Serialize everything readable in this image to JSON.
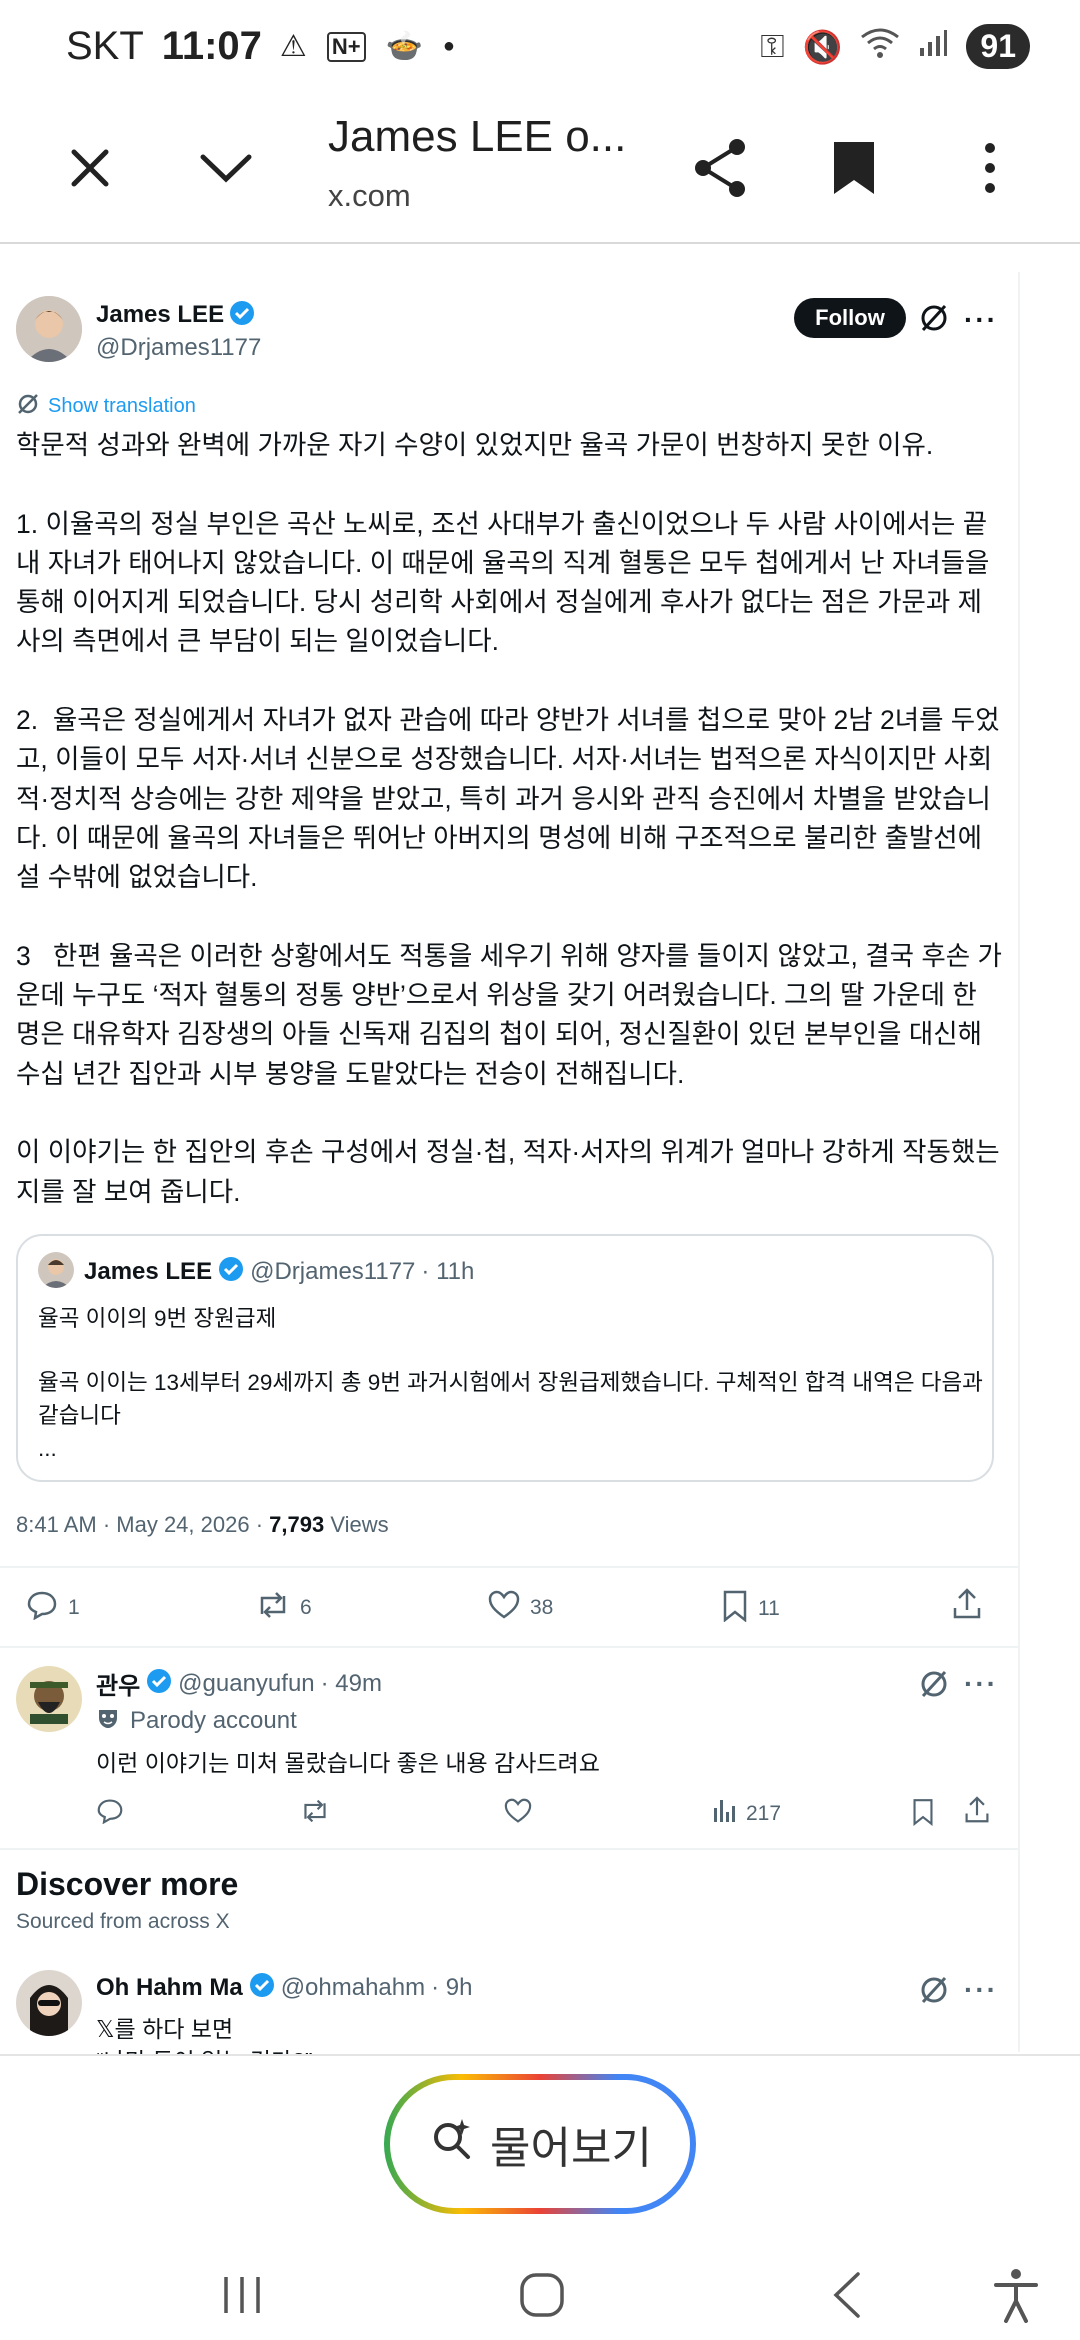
{
  "status_bar": {
    "carrier": "SKT",
    "time": "11:07",
    "battery": "91"
  },
  "browser": {
    "title": "James LEE o...",
    "url": "x.com"
  },
  "tweet": {
    "author_name": "James LEE",
    "author_handle": "@Drjames1177",
    "follow_label": "Follow",
    "translate_label": "Show translation",
    "text": "학문적 성과와 완벽에 가까운 자기 수양이 있었지만 율곡 가문이 번창하지 못한 이유.\n\n1. 이율곡의 정실 부인은 곡산 노씨로, 조선 사대부가 출신이었으나 두 사람 사이에서는 끝내 자녀가 태어나지 않았습니다. 이 때문에 율곡의 직계 혈통은 모두 첩에게서 난 자녀들을 통해 이어지게 되었습니다. 당시 성리학 사회에서 정실에게 후사가 없다는 점은 가문과 제사의 측면에서 큰 부담이 되는 일이었습니다.\n\n2.  율곡은 정실에게서 자녀가 없자 관습에 따라 양반가 서녀를 첩으로 맞아 2남 2녀를 두었고, 이들이 모두 서자·서녀 신분으로 성장했습니다. 서자·서녀는 법적으론 자식이지만 사회적·정치적 상승에는 강한 제약을 받았고, 특히 과거 응시와 관직 승진에서 차별을 받았습니다. 이 때문에 율곡의 자녀들은 뛰어난 아버지의 명성에 비해 구조적으로 불리한 출발선에 설 수밖에 없었습니다.\n\n3   한편 율곡은 이러한 상황에서도 적통을 세우기 위해 양자를 들이지 않았고, 결국 후손 가운데 누구도 ‘적자 혈통의 정통 양반’으로서 위상을 갖기 어려웠습니다. 그의 딸 가운데 한 명은 대유학자 김장생의 아들 신독재 김집의 첩이 되어, 정신질환이 있던 본부인을 대신해 수십 년간 집안과 시부 봉양을 도맡았다는 전승이 전해집니다.\n\n이 이야기는 한 집안의 후손 구성에서 정실·첩, 적자·서자의 위계가 얼마나 강하게 작동했는지를 잘 보여 줍니다.",
    "quote": {
      "author_name": "James LEE",
      "author_handle": "@Drjames1177",
      "time": "· 11h",
      "line1": "율곡 이이의 9번 장원급제",
      "line2": "율곡 이이는 13세부터 29세까지 총 9번 과거시험에서 장원급제했습니다. 구체적인 합격 내역은 다음과 같습니다",
      "ellipsis": "..."
    },
    "timestamp": "8:41 AM · May 24, 2026 · ",
    "views_count": "7,793",
    "views_label": " Views",
    "replies": "1",
    "reposts": "6",
    "likes": "38",
    "bookmarks": "11"
  },
  "reply": {
    "author_name": "관우",
    "author_handle": "@guanyufun",
    "time": "· 49m",
    "parody_label": "Parody account",
    "text": "이런 이야기는 미처 몰랐습니다 좋은 내용 감사드려요",
    "views": "217"
  },
  "discover": {
    "title": "Discover more",
    "subtitle": "Sourced from across X",
    "post": {
      "author_name": "Oh Hahm Ma",
      "author_handle": "@ohmahahm",
      "time": "· 9h",
      "line1": "𝕏를 하다 보면",
      "line2": "“나만 돈이 없는 건가?”"
    }
  },
  "bottom": {
    "ask_label": "물어보기"
  },
  "colors": {
    "accent_blue": "#1d9bf0",
    "text": "#0f1419",
    "muted": "#536471"
  }
}
